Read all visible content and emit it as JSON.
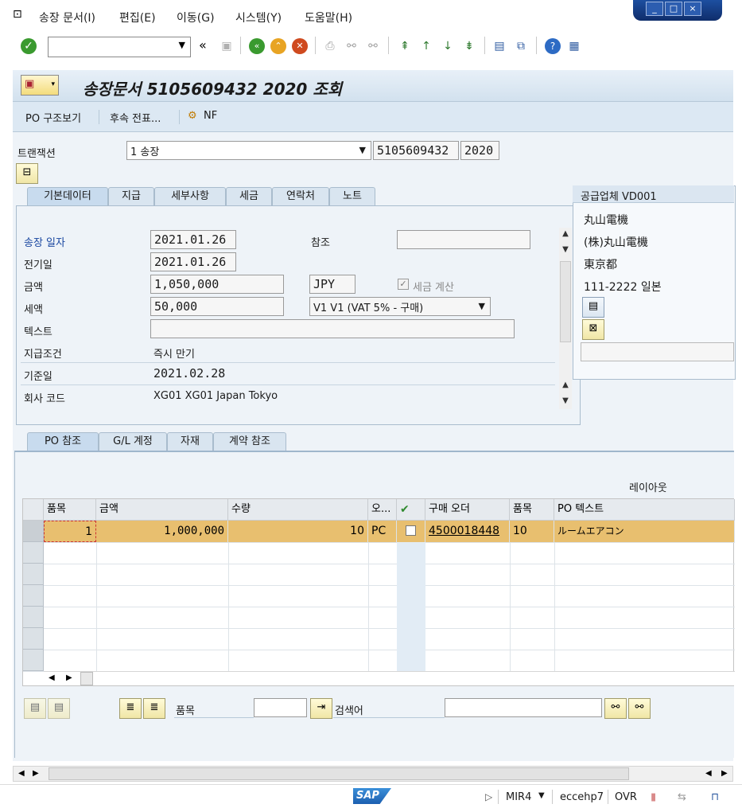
{
  "menu": {
    "items": [
      "송장 문서(I)",
      "편집(E)",
      "이동(G)",
      "시스템(Y)",
      "도움말(H)"
    ]
  },
  "toolbar": {
    "command_value": "",
    "back_glyph": "«",
    "icons": [
      "enter-icon",
      "save-icon",
      "back-icon",
      "exit-icon",
      "cancel-icon",
      "print-icon",
      "find-icon",
      "find-next-icon",
      "first-page-icon",
      "prev-page-icon",
      "next-page-icon",
      "last-page-icon",
      "new-session-icon",
      "shortcut-icon",
      "help-icon",
      "customize-layout-icon"
    ]
  },
  "title": {
    "text": "송장문서 5105609432 2020 조회"
  },
  "app_toolbar": {
    "po_structure": "PO 구조보기",
    "follow_on": "후속 전표...",
    "nf": "NF"
  },
  "transaction": {
    "label": "트랜잭션",
    "value": "1 송장",
    "doc_number": "5105609432",
    "year": "2020"
  },
  "header_tabs": [
    "기본데이터",
    "지급",
    "세부사항",
    "세금",
    "연락처",
    "노트"
  ],
  "basic_data": {
    "invoice_date_label": "송장 일자",
    "invoice_date": "2021.01.26",
    "reference_label": "참조",
    "reference": "",
    "posting_date_label": "전기일",
    "posting_date": "2021.01.26",
    "amount_label": "금액",
    "amount": "1,050,000",
    "currency": "JPY",
    "calc_tax_label": "세금 계산",
    "calc_tax_checked": true,
    "tax_amount_label": "세액",
    "tax_amount": "50,000",
    "tax_code": "V1 V1 (VAT 5% - 구매)",
    "text_label": "텍스트",
    "text": "",
    "payment_terms_label": "지급조건",
    "payment_terms": "즉시 만기",
    "baseline_date_label": "기준일",
    "baseline_date": "2021.02.28",
    "company_code_label": "회사 코드",
    "company_code": "XG01 XG01 Japan Tokyo"
  },
  "vendor": {
    "title": "공급업체 VD001",
    "line1": "丸山電機",
    "line2": "(株)丸山電機",
    "line3": "東京都",
    "line4": "111-2222 일본"
  },
  "item_tabs": [
    "PO 참조",
    "G/L 계정",
    "자재",
    "계약 참조"
  ],
  "layout_label": "레이아웃",
  "grid": {
    "headers": [
      "품목",
      "금액",
      "수량",
      "오...",
      "",
      "구매 오더",
      "품목",
      "PO 텍스트"
    ],
    "rows": [
      {
        "item": "1",
        "amount": "1,000,000",
        "qty": "10",
        "unit": "PC",
        "po": "4500018448",
        "po_item": "10",
        "po_text": "ルームエアコン"
      }
    ]
  },
  "bottom": {
    "item_label": "품목",
    "item_value": "",
    "search_label": "검색어",
    "search_value": ""
  },
  "status": {
    "transaction": "MIR4",
    "server": "eccehp7",
    "mode": "OVR",
    "logo": "SAP"
  },
  "colors": {
    "selected_row": "#e8bf6f",
    "title_bg": "#d2e1ee",
    "link": "#1a1a1a"
  }
}
